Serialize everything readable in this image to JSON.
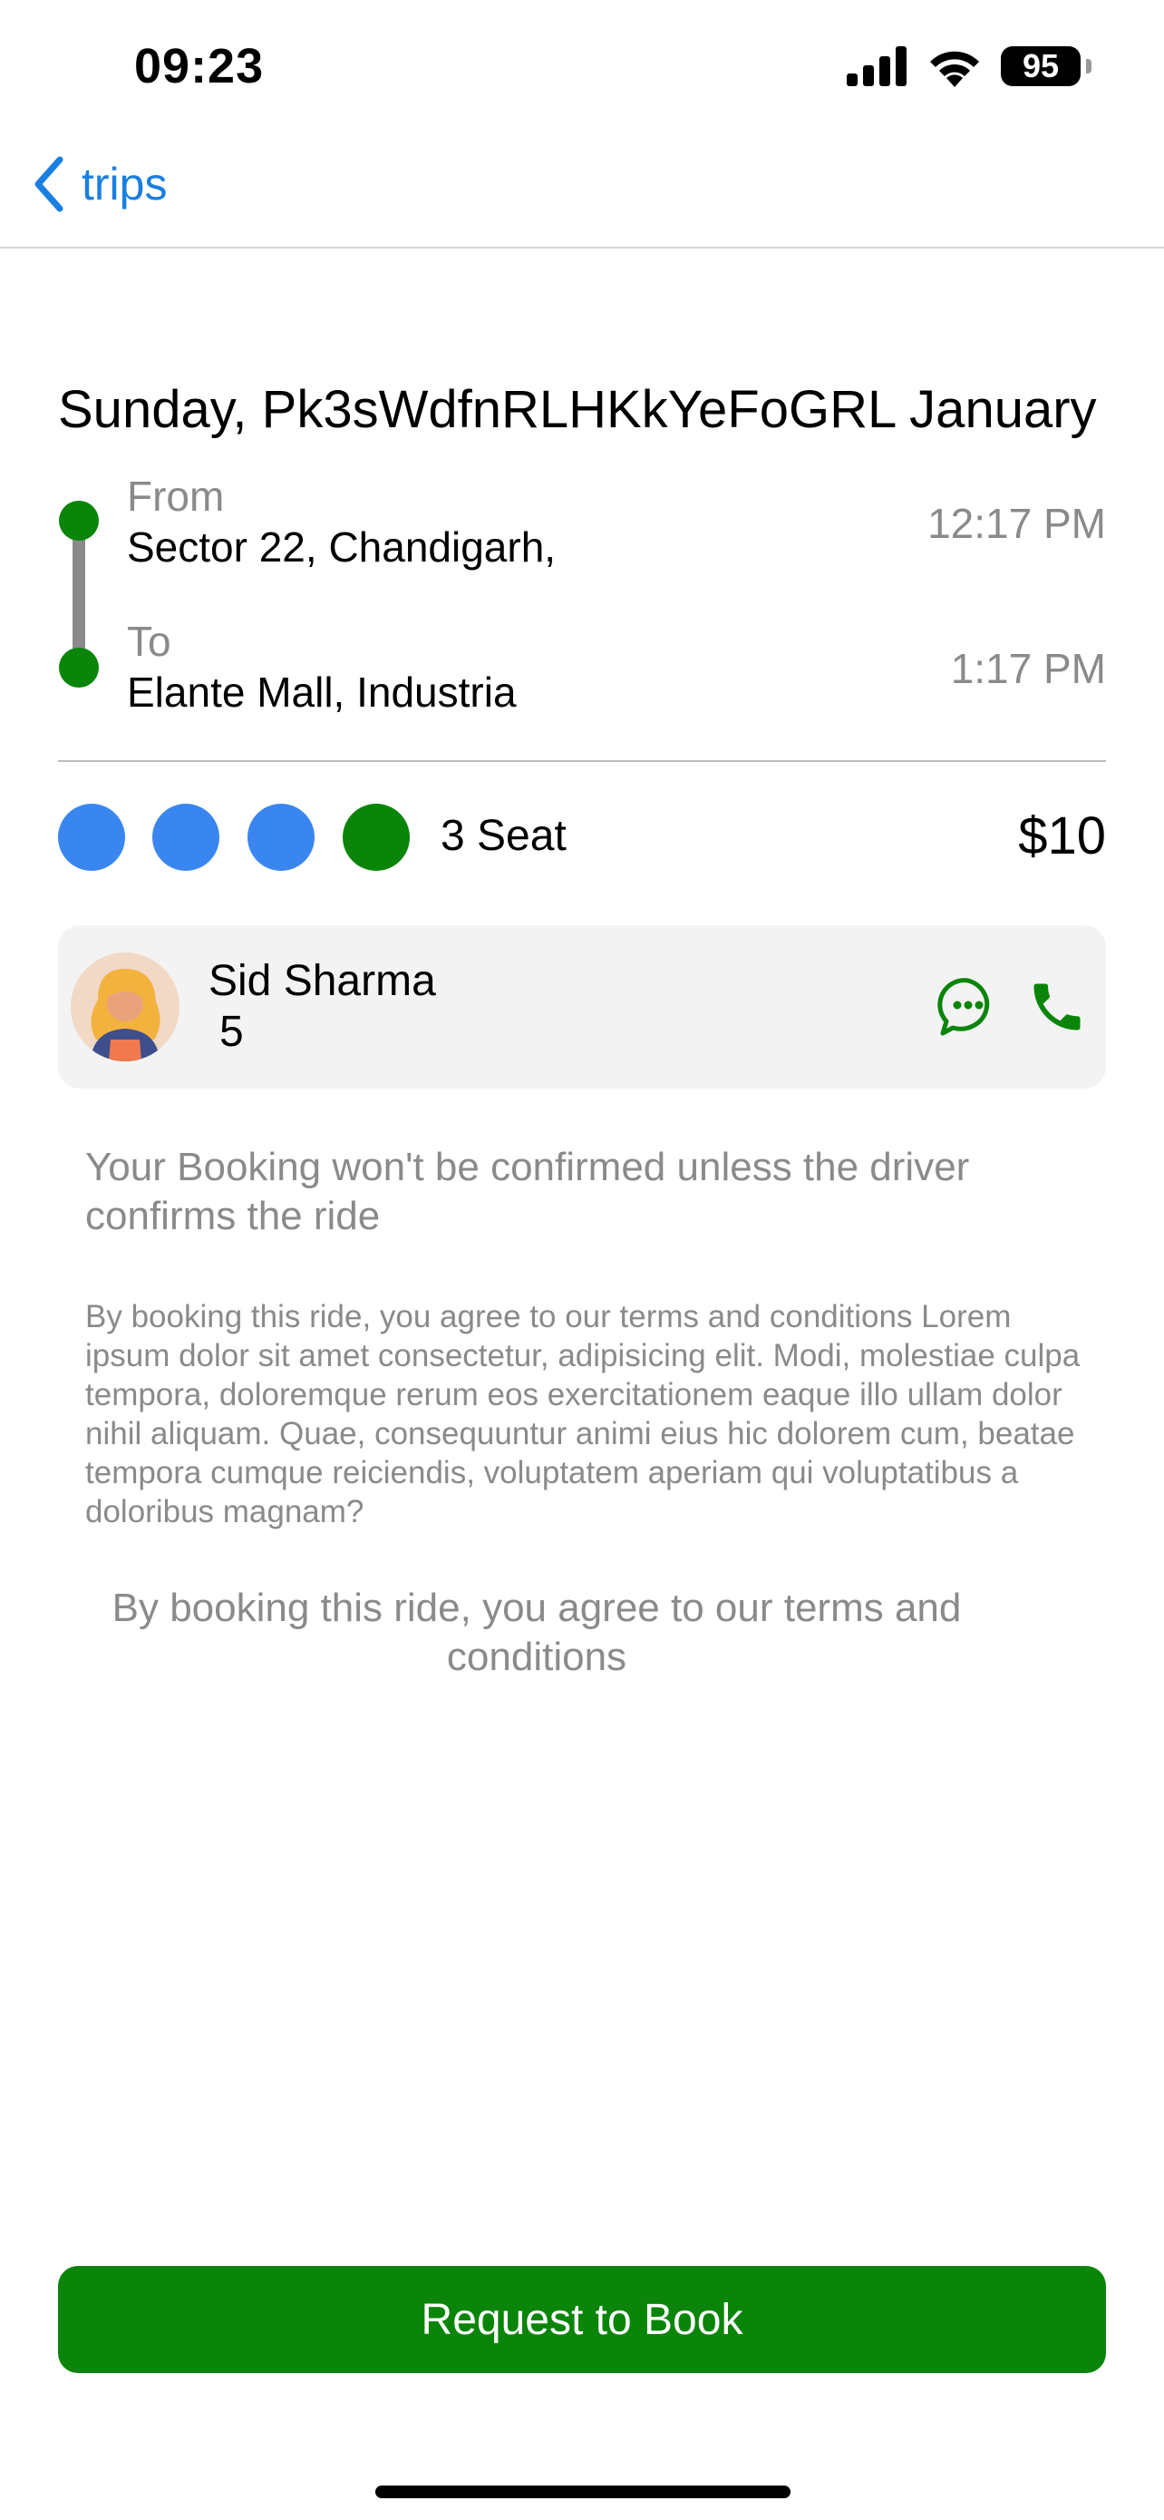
{
  "status_bar": {
    "time": "09:23",
    "battery": "95"
  },
  "nav": {
    "back_label": "trips"
  },
  "trip": {
    "title": "Sunday, Pk3sWdfnRLHKkYeFoGRL January",
    "from_label": "From",
    "from_place": "Sector 22, Chandigarh,",
    "from_time": "12:17 PM",
    "to_label": "To",
    "to_place": "Elante Mall, Industria",
    "to_time": "1:17 PM"
  },
  "seats": {
    "count_label": "3 Seat",
    "price": "$10",
    "colors": {
      "available": "#3a86f0",
      "selected": "#0a850a"
    }
  },
  "driver": {
    "name": "Sid Sharma",
    "rating": "5"
  },
  "notes": {
    "confirmation": "Your Booking won't be confirmed unless the driver confirms the ride",
    "terms_body": "By booking this ride, you agree to our terms and conditions Lorem ipsum dolor sit amet consectetur, adipisicing elit. Modi, molestiae culpa tempora, doloremque rerum eos exercitationem eaque illo ullam dolor nihil aliquam. Quae, consequuntur animi eius hic dolorem cum, beatae tempora cumque reiciendis, voluptatem aperiam qui voluptatibus a doloribus magnam?",
    "terms_short": "By booking this ride, you agree to our terms and conditions"
  },
  "actions": {
    "book_label": "Request to Book"
  },
  "theme": {
    "accent_green": "#0a850a",
    "link_blue": "#1a7fe0",
    "muted_text": "#8a8a8a"
  }
}
